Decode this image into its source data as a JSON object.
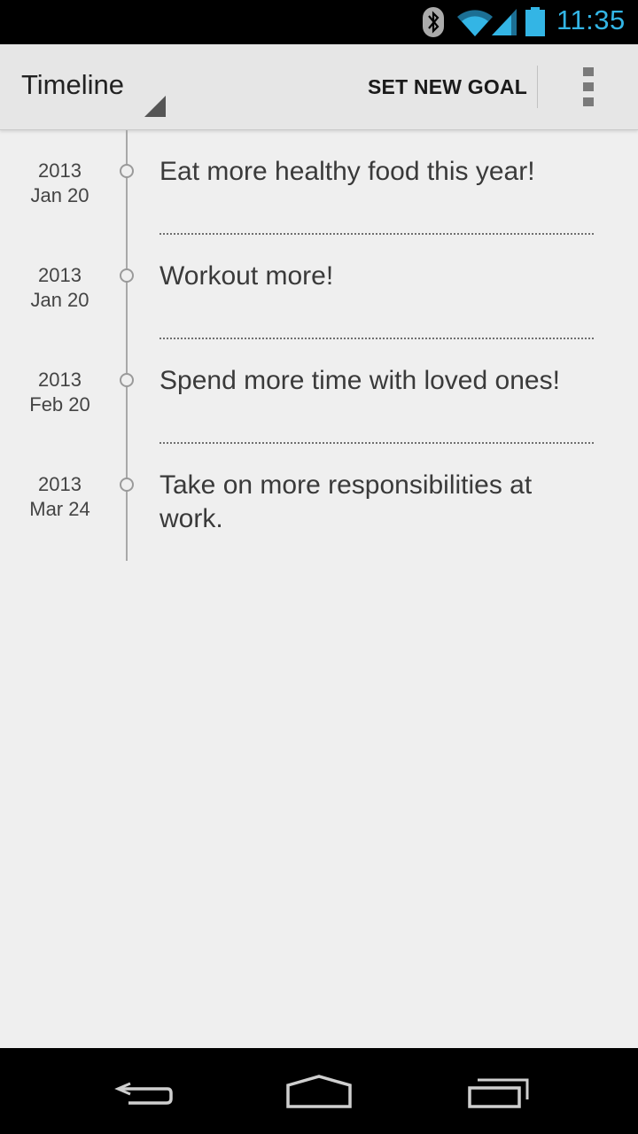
{
  "status_bar": {
    "time": "11:35",
    "icons": [
      "bluetooth-icon",
      "wifi-icon",
      "signal-icon",
      "battery-icon"
    ],
    "clock_color": "#33b5e5"
  },
  "action_bar": {
    "title": "Timeline",
    "action_label": "SET NEW GOAL",
    "overflow_icon": "overflow-menu-icon"
  },
  "timeline": {
    "entries": [
      {
        "year": "2013",
        "date": "Jan 20",
        "text": "Eat more healthy food this year!"
      },
      {
        "year": "2013",
        "date": "Jan 20",
        "text": "Workout more!"
      },
      {
        "year": "2013",
        "date": "Feb 20",
        "text": "Spend more time with loved ones!"
      },
      {
        "year": "2013",
        "date": "Mar 24",
        "text": "Take on more responsibilities at work."
      }
    ]
  },
  "nav_bar": {
    "icons": [
      "back-icon",
      "home-icon",
      "recent-apps-icon"
    ]
  }
}
